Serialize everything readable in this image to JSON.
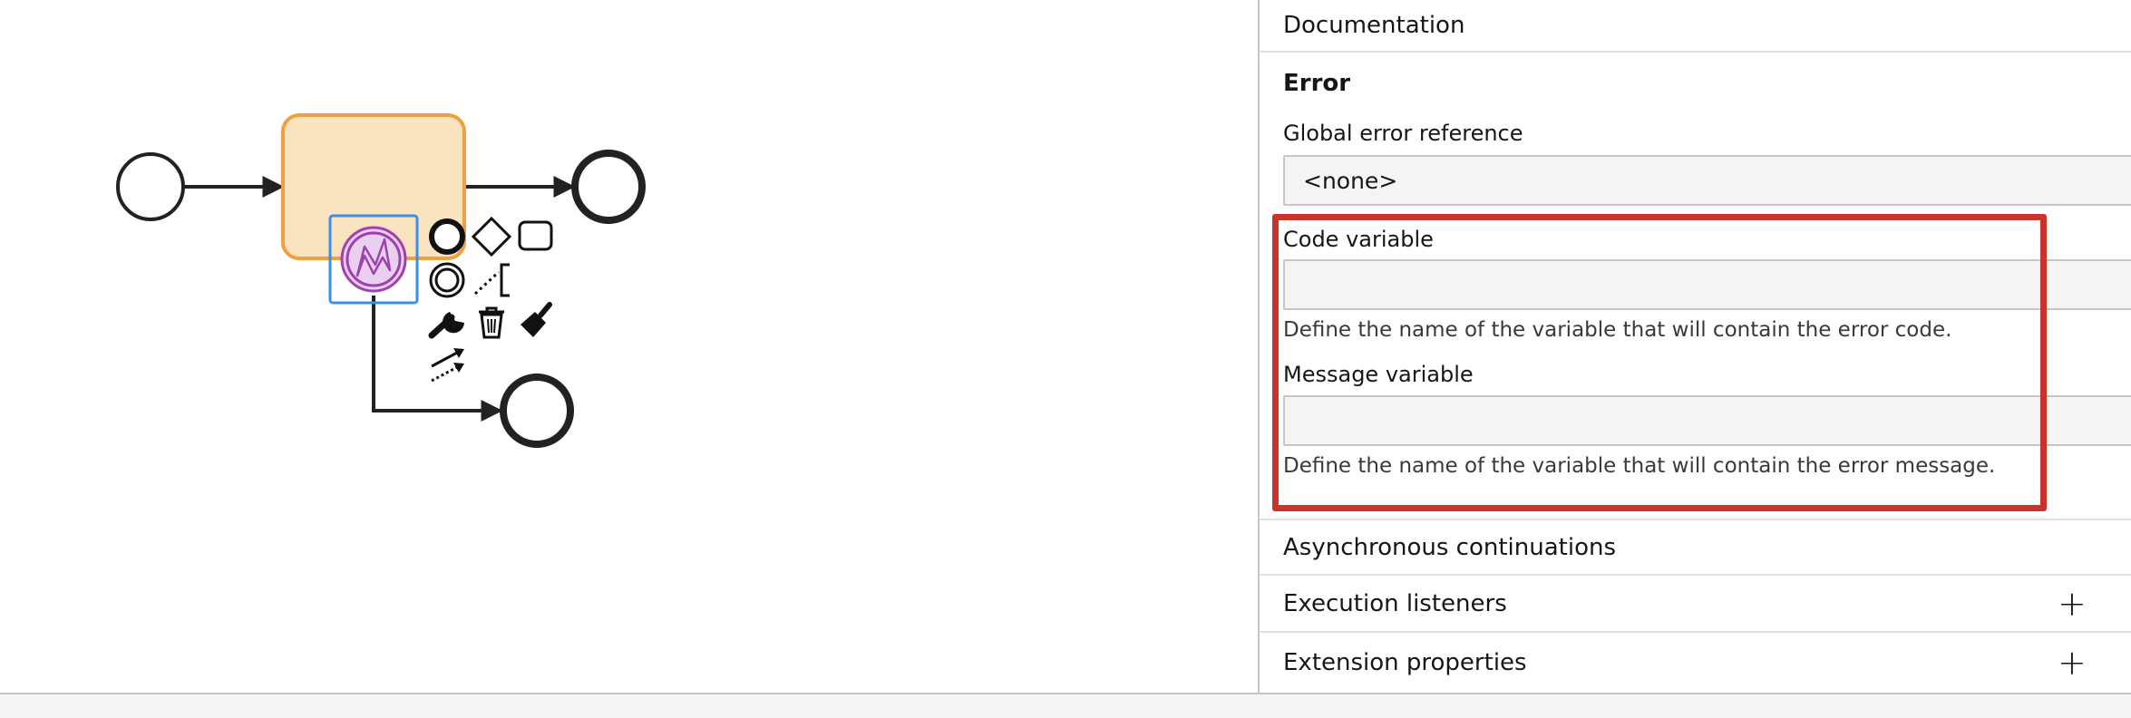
{
  "panel": {
    "documentation_label": "Documentation",
    "error_group": {
      "title": "Error",
      "global_error_reference": {
        "label": "Global error reference",
        "value": "<none>"
      },
      "code_variable": {
        "label": "Code variable",
        "value": "",
        "description": "Define the name of the variable that will contain the error code."
      },
      "message_variable": {
        "label": "Message variable",
        "value": "",
        "description": "Define the name of the variable that will contain the error message."
      }
    },
    "async_label": "Asynchronous continuations",
    "execution_listeners_label": "Execution listeners",
    "extension_properties_label": "Extension properties",
    "add_symbol": "+"
  },
  "colors": {
    "task_fill": "#fae3bf",
    "task_stroke": "#f0a040",
    "boundary_fill": "#e8d0ee",
    "boundary_stroke": "#a040b0",
    "selection": "#3c8ee6",
    "highlight": "#c8342a",
    "stroke": "#222222"
  },
  "diagram": {
    "elements": [
      "start-event",
      "task",
      "end-event",
      "error-boundary-event",
      "error-end-event"
    ],
    "context_pad": [
      "end-event-icon",
      "gateway-icon",
      "task-icon",
      "intermediate-event-icon",
      "text-annotation-icon",
      "change-type-icon",
      "delete-icon",
      "color-icon",
      "connect-icon"
    ]
  }
}
